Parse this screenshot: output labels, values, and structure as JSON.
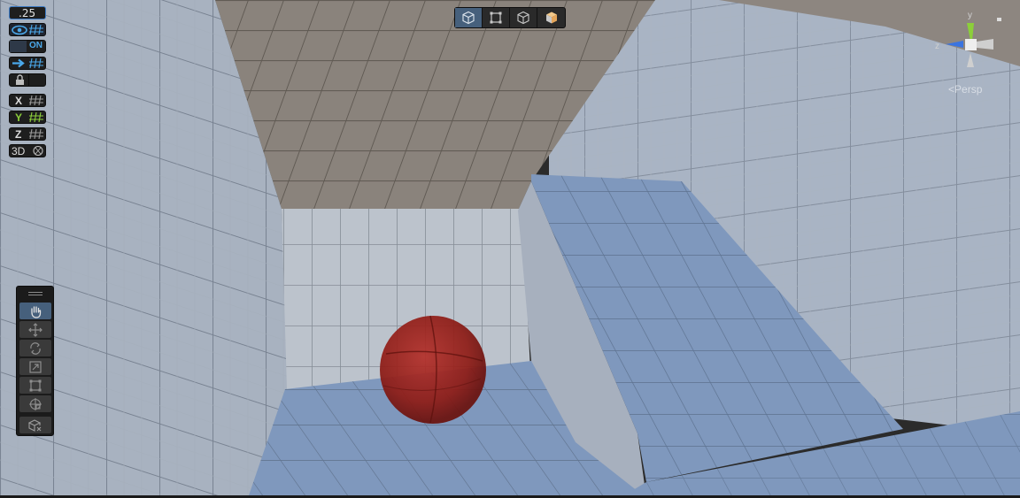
{
  "snap_toolbar": {
    "increment_value": ".25",
    "grid_visibility_icon": "eye-grid-icon",
    "toggle_label": "ON",
    "move_snap_icon": "arrow-grid-icon",
    "lock_icon": "lock-icon",
    "axis_x": "X",
    "axis_y": "Y",
    "axis_z": "Z",
    "mode_3d": "3D"
  },
  "view_toolbar": {
    "buttons": [
      {
        "icon": "cube-wireframe-icon",
        "active": true
      },
      {
        "icon": "rect-select-icon",
        "active": false
      },
      {
        "icon": "cube-outline-icon",
        "active": false
      },
      {
        "icon": "cube-solid-icon",
        "active": false
      }
    ]
  },
  "tools": [
    {
      "icon": "hand-icon",
      "active": true
    },
    {
      "icon": "move-icon",
      "active": false
    },
    {
      "icon": "rotate-icon",
      "active": false
    },
    {
      "icon": "scale-icon",
      "active": false
    },
    {
      "icon": "rect-transform-icon",
      "active": false
    },
    {
      "icon": "transform-icon",
      "active": false
    },
    {
      "icon": "custom-tool-icon",
      "active": false
    }
  ],
  "gizmo": {
    "y_label": "y",
    "z_label": "z",
    "projection_label": "Persp"
  },
  "colors": {
    "accent_blue": "#4a90d6",
    "active_button": "#46607c",
    "x_axis": "#d94c3a",
    "y_axis": "#8ccf3a",
    "z_axis": "#3a74e0",
    "sphere": "#8e1c16"
  }
}
